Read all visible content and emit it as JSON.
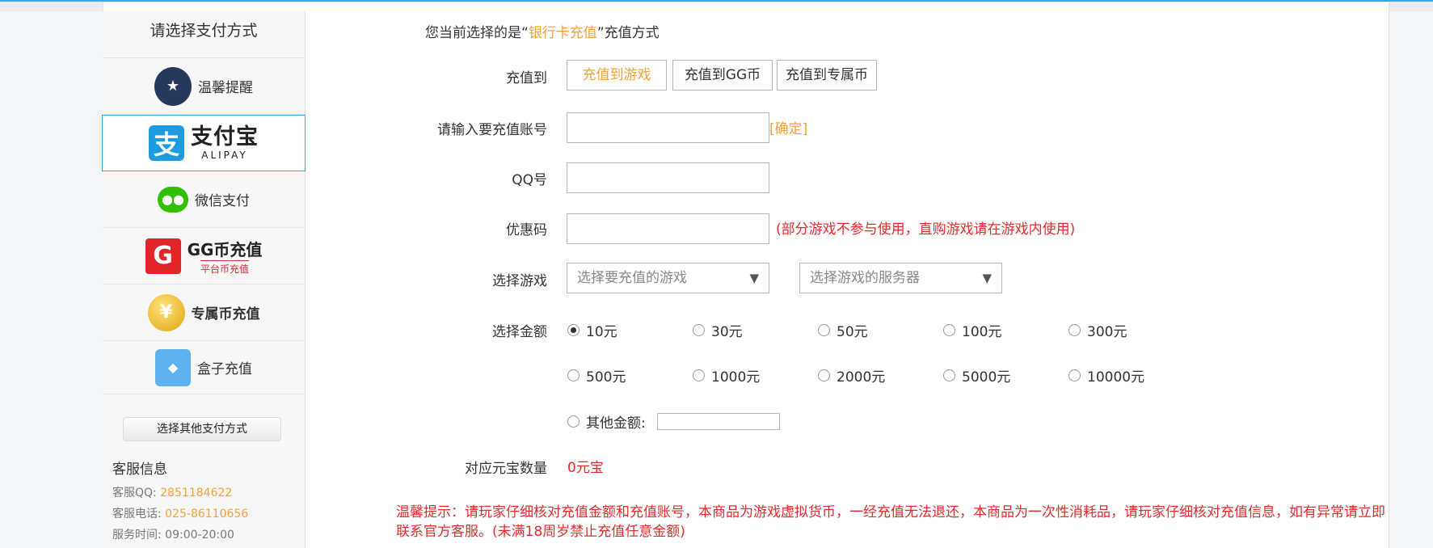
{
  "sidebar": {
    "title": "请选择支付方式",
    "items": [
      {
        "label": "温馨提醒",
        "icon": "police-mascot-icon"
      },
      {
        "label": "支付宝",
        "sub": "ALIPAY",
        "icon": "alipay-icon"
      },
      {
        "label": "微信支付",
        "icon": "wechat-icon"
      },
      {
        "label": "GG币充值",
        "sub": "平台币充值",
        "icon": "gg-coin-icon"
      },
      {
        "label": "专属币充值",
        "icon": "gold-coin-icon"
      },
      {
        "label": "盒子充值",
        "icon": "box-mascot-icon"
      }
    ],
    "other_button": "选择其他支付方式",
    "support": {
      "title": "客服信息",
      "qq_label": "客服QQ: ",
      "qq": "2851184622",
      "phone_label": "客服电话: ",
      "phone": "025-86110656",
      "hours_label": "服务时间: ",
      "hours": "09:00-20:00"
    }
  },
  "main": {
    "current_prefix": "您当前选择的是“",
    "current_method": "银行卡充值",
    "current_suffix": "”充值方式",
    "labels": {
      "recharge_to": "充值到",
      "account": "请输入要充值账号",
      "qq": "QQ号",
      "coupon": "优惠码",
      "game": "选择游戏",
      "amount": "选择金额",
      "ingot": "对应元宝数量"
    },
    "tabs": [
      "充值到游戏",
      "充值到GG币",
      "充值到专属币"
    ],
    "confirm": "[确定]",
    "coupon_note": "(部分游戏不参与使用，直购游戏请在游戏内使用)",
    "game_placeholder": "选择要充值的游戏",
    "server_placeholder": "选择游戏的服务器",
    "amounts": [
      "10元",
      "30元",
      "50元",
      "100元",
      "300元",
      "500元",
      "1000元",
      "2000元",
      "5000元",
      "10000元"
    ],
    "selected_amount": "10元",
    "other_amount_label": "其他金额:",
    "ingot_value": "0元宝",
    "warning": "温馨提示：请玩家仔细核对充值金额和充值账号，本商品为游戏虚拟货币，一经充值无法退还，本商品为一次性消耗品，请玩家仔细核对充值信息，如有异常请立即联系官方客服。(未满18周岁禁止充值任意金额)",
    "colors": {
      "accent": "#f5a13a",
      "warning": "#e62b2b",
      "border_active": "#3aa6e6"
    }
  }
}
